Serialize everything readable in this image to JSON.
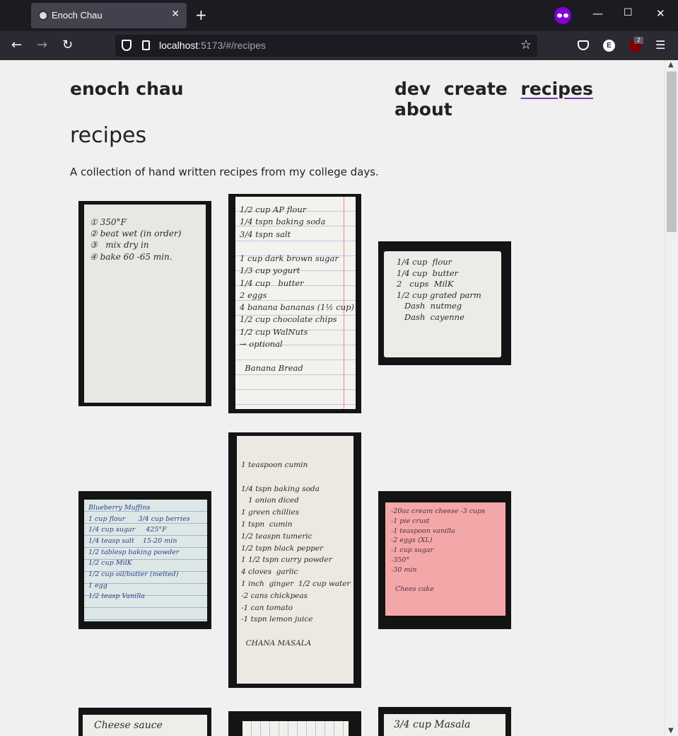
{
  "browser": {
    "tab_title": "Enoch Chau",
    "url_host": "localhost",
    "url_rest": ":5173/#/recipes"
  },
  "site": {
    "title": "enoch chau",
    "nav": [
      "dev",
      "create",
      "recipes",
      "about"
    ],
    "active_nav": "recipes"
  },
  "page": {
    "heading": "recipes",
    "description": "A collection of hand written recipes from my college days."
  },
  "recipes": [
    {
      "name": "bake-time-card",
      "lines": "① 350°F\n② beat wet (in order)\n③   mix dry in\n④ bake 60 -65 min."
    },
    {
      "name": "banana-bread",
      "lines": "1/2 cup AP flour\n1/4 tspn baking soda\n3/4 tspn salt\n\n1 cup dark brown sugar\n1/3 cup yogurt\n1/4 cup   butter\n2 eggs\n4 banana bananas (1½ cup)\n1/2 cup chocolate chips\n1/2 cup WalNuts\n→ optional\n\n  Banana Bread"
    },
    {
      "name": "cheese-crackers",
      "lines": "1/4 cup  flour\n1/4 cup  butter\n2   cups  MilK\n1/2 cup grated parm\n   Dash  nutmeg\n   Dash  cayenne"
    },
    {
      "name": "blueberry-muffins",
      "lines": "Blueberry Muffins\n1 cup flour      3/4 cup berries\n1/4 cup sugar     425°F\n1/4 teasp salt    15-20 min\n1/2 tablesp baking powder\n1/2 cup MilK\n1/2 cup oil/butter (melted)\n1 egg\n1/2 teasp Vanilla"
    },
    {
      "name": "chana-masala",
      "lines": "1 teaspoon cumin\n\n1/4 tspn baking soda\n   1 onion diced\n1 green chillies\n1 tspn  cumin\n1/2 teaspn tumeric\n1/2 tspn black pepper\n1 1/2 tspn curry powder\n4 cloves  garlic\n1 inch  ginger  1/2 cup water\n-2 cans chickpeas\n-1 can tomato\n-1 tspn lemon juice\n\n  CHANA MASALA"
    },
    {
      "name": "cheesecake",
      "lines": "-20oz cream cheese -3 cups\n-1 pie crust\n-1 teaspoon vanilla\n-2 eggs (XL)\n-1 cup sugar\n-350°\n-30 min\n\n  Chees cake"
    },
    {
      "name": "cheese-sauce",
      "lines": "Cheese sauce"
    },
    {
      "name": "lined-card",
      "lines": ""
    },
    {
      "name": "masala-card",
      "lines": "3/4 cup Masala"
    }
  ]
}
